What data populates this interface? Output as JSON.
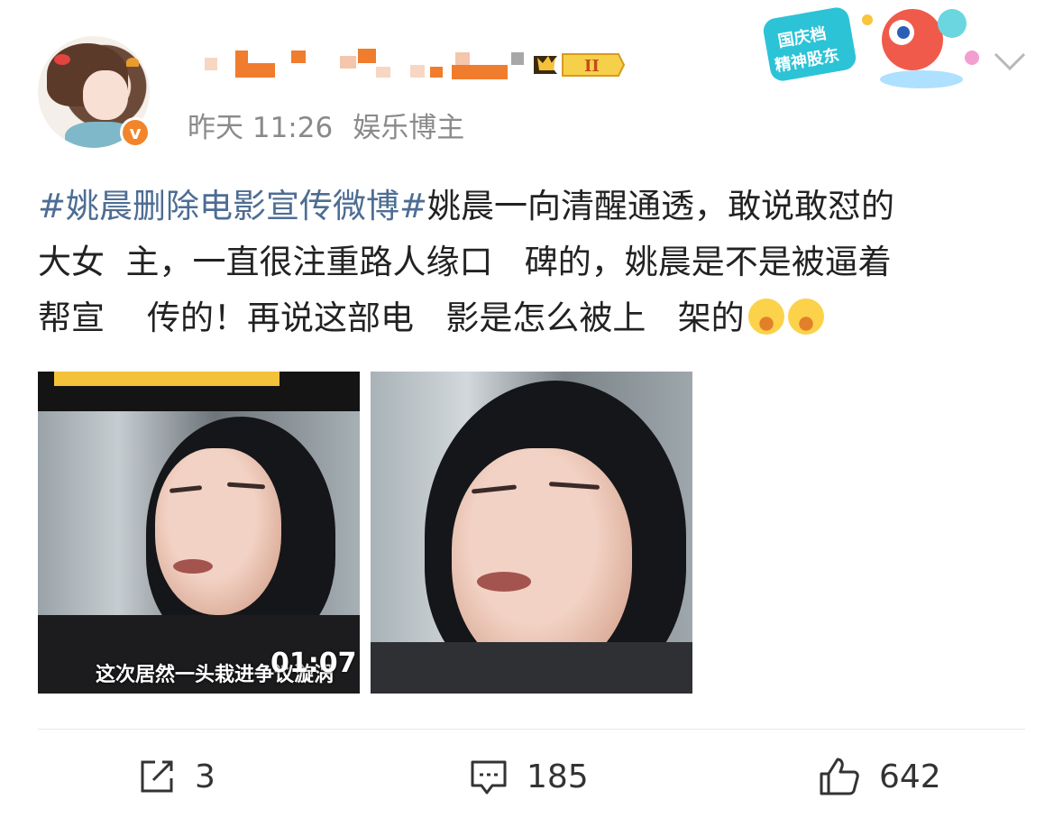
{
  "header": {
    "username": "",
    "rank_badge": "II",
    "time": "昨天 11:26",
    "category": "娱乐博主",
    "sticker_lines": [
      "国庆档",
      "精神股东"
    ],
    "verified_mark": "v"
  },
  "post": {
    "hashtag": "#姚晨删除电影宣传微博#",
    "line1_rest": "姚晨一向清醒通透，敢说敢怼的",
    "line2": "大女  主，一直很注重路人缘口   碑的，姚晨是不是被逼着",
    "line3": "帮宣    传的！再说这部电   影是怎么被上   架的"
  },
  "media": {
    "image1_caption": "这次居然一头栽进争议漩涡",
    "image1_timer": "01:07"
  },
  "actions": {
    "share_count": "3",
    "comment_count": "185",
    "like_count": "642"
  },
  "colors": {
    "hashtag": "#4d6d94",
    "meta": "#8a8a8a",
    "verified": "#f2842a"
  }
}
